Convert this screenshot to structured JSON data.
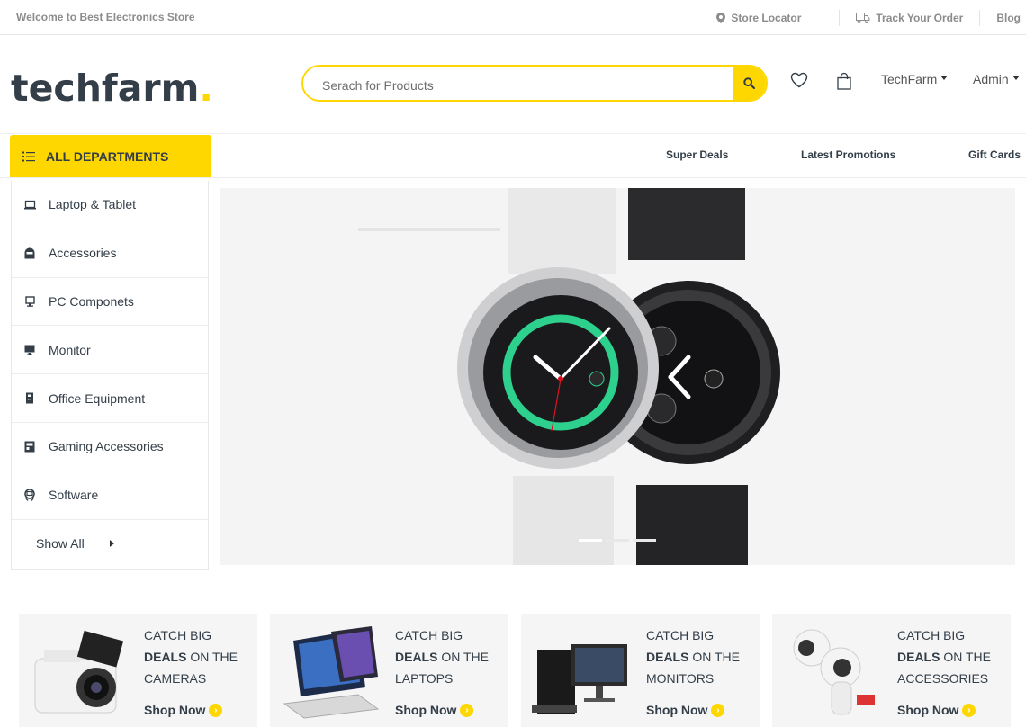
{
  "topbar": {
    "welcome": "Welcome to Best Electronics Store",
    "store_locator": "Store Locator",
    "track_order": "Track Your Order",
    "blog": "Blog"
  },
  "header": {
    "logo_text": "techfarm",
    "logo_dot": ".",
    "search_placeholder": "Serach for Products",
    "store_dropdown": "TechFarm",
    "admin_dropdown": "Admin"
  },
  "nav": {
    "departments": "ALL DEPARTMENTS",
    "links": [
      "Super Deals",
      "Latest Promotions",
      "Gift Cards"
    ]
  },
  "sidebar": {
    "items": [
      {
        "label": "Laptop & Tablet",
        "icon": "laptop-icon"
      },
      {
        "label": "Accessories",
        "icon": "helmet-icon"
      },
      {
        "label": "PC Componets",
        "icon": "pc-icon"
      },
      {
        "label": "Monitor",
        "icon": "monitor-icon"
      },
      {
        "label": "Office Equipment",
        "icon": "office-icon"
      },
      {
        "label": "Gaming Accessories",
        "icon": "gamepad-icon"
      },
      {
        "label": "Software",
        "icon": "software-icon"
      }
    ],
    "show_all": "Show All"
  },
  "promos": [
    {
      "line1": "CATCH BIG",
      "bold": "DEALS",
      "line2": " ON THE",
      "category": "CAMERAS",
      "cta": "Shop Now"
    },
    {
      "line1": "CATCH BIG",
      "bold": "DEALS",
      "line2": " ON THE",
      "category": "LAPTOPS",
      "cta": "Shop Now"
    },
    {
      "line1": "CATCH BIG",
      "bold": "DEALS",
      "line2": " ON THE",
      "category": "MONITORS",
      "cta": "Shop Now"
    },
    {
      "line1": "CATCH BIG",
      "bold": "DEALS",
      "line2": " ON THE",
      "category": "ACCESSORIES",
      "cta": "Shop Now"
    }
  ],
  "colors": {
    "accent": "#fed700",
    "text": "#333e48",
    "muted": "#8c8c8c"
  }
}
